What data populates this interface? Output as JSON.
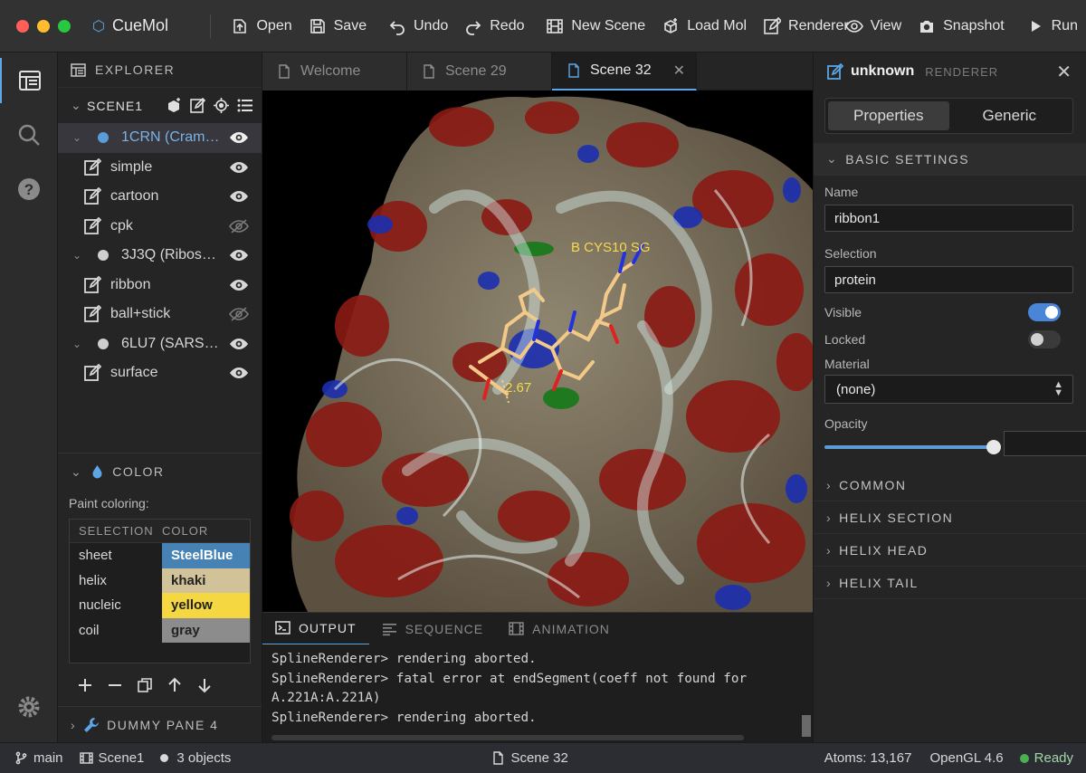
{
  "app": {
    "name": "CueMol",
    "accent_color": "#5aa6e6"
  },
  "toolbar": {
    "open": "Open",
    "save": "Save",
    "undo": "Undo",
    "redo": "Redo",
    "new_scene": "New Scene",
    "load_mol": "Load Mol",
    "renderer": "Renderer",
    "view": "View",
    "snapshot": "Snapshot",
    "run": "Run"
  },
  "explorer": {
    "title": "EXPLORER",
    "scene_name": "SCENE1",
    "objects": [
      {
        "label": "1CRN (Cram…",
        "dot_color": "#5a9bd8",
        "visible": true,
        "renderers": [
          {
            "label": "simple",
            "visible": true
          },
          {
            "label": "cartoon",
            "visible": true
          },
          {
            "label": "cpk",
            "visible": false
          }
        ]
      },
      {
        "label": "3J3Q (Ribos…",
        "dot_color": "#cfcfcf",
        "visible": true,
        "renderers": [
          {
            "label": "ribbon",
            "visible": true
          },
          {
            "label": "ball+stick",
            "visible": false
          }
        ]
      },
      {
        "label": "6LU7 (SARS…",
        "dot_color": "#cfcfcf",
        "visible": true,
        "renderers": [
          {
            "label": "surface",
            "visible": true
          }
        ]
      }
    ]
  },
  "color_pane": {
    "title": "COLOR",
    "paint_label": "Paint coloring:",
    "col_selection": "SELECTION",
    "col_color": "COLOR",
    "rows": [
      {
        "selection": "sheet",
        "color": "SteelBlue",
        "swatch": "#4682b4",
        "text_color": "#ffffff"
      },
      {
        "selection": "helix",
        "color": "khaki",
        "swatch": "#d2c29a",
        "text_color": "#2a2a2a"
      },
      {
        "selection": "nucleic",
        "color": "yellow",
        "swatch": "#f5d742",
        "text_color": "#2a2a2a"
      },
      {
        "selection": "coil",
        "color": "gray",
        "swatch": "#8c8c8c",
        "text_color": "#2a2a2a"
      }
    ]
  },
  "dummy_pane": {
    "title": "DUMMY PANE 4"
  },
  "tabs": [
    {
      "label": "Welcome",
      "active": false
    },
    {
      "label": "Scene 29",
      "active": false
    },
    {
      "label": "Scene 32",
      "active": true
    }
  ],
  "viewport": {
    "atom_label": "B CYS10 SG",
    "distance_label": "2.67"
  },
  "panel": {
    "tabs": [
      "OUTPUT",
      "SEQUENCE",
      "ANIMATION"
    ],
    "log": [
      "SplineRenderer> rendering aborted.",
      "SplineRenderer> fatal error at endSegment(coeff not found for",
      "A.221A:A.221A)",
      "SplineRenderer> rendering aborted."
    ]
  },
  "properties": {
    "title": "unknown",
    "subtitle": "RENDERER",
    "tab_properties": "Properties",
    "tab_generic": "Generic",
    "section_basic": "BASIC SETTINGS",
    "name_label": "Name",
    "name_value": "ribbon1",
    "selection_label": "Selection",
    "selection_value": "protein",
    "visible_label": "Visible",
    "visible_on": true,
    "locked_label": "Locked",
    "locked_on": false,
    "material_label": "Material",
    "material_value": "(none)",
    "opacity_label": "Opacity",
    "opacity_value": 1.0,
    "sections": [
      "COMMON",
      "HELIX SECTION",
      "HELIX HEAD",
      "HELIX TAIL"
    ]
  },
  "statusbar": {
    "branch": "main",
    "scene": "Scene1",
    "objects": "3 objects",
    "active_tab": "Scene 32",
    "atoms": "Atoms: 13,167",
    "renderer": "OpenGL 4.6",
    "state": "Ready"
  }
}
